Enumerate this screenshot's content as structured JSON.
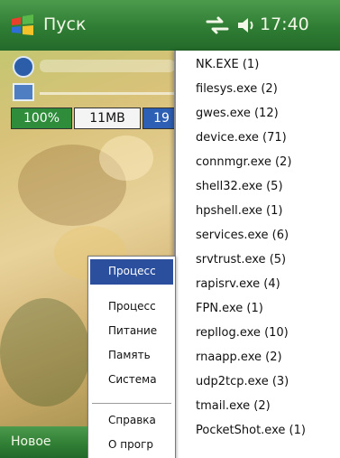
{
  "title_bar": {
    "start_label": "Пуск",
    "time": "17:40",
    "icons": [
      "windows-flag-icon",
      "connectivity-icon",
      "volume-icon"
    ]
  },
  "status_row": {
    "battery": "100%",
    "memory": "11MB",
    "cpu": "19"
  },
  "process_list": [
    "NK.EXE (1)",
    "filesys.exe (2)",
    "gwes.exe (12)",
    "device.exe (71)",
    "connmgr.exe (2)",
    "shell32.exe (5)",
    "hpshell.exe (1)",
    "services.exe (6)",
    "srvtrust.exe (5)",
    "rapisrv.exe (4)",
    "FPN.exe (1)",
    "repllog.exe (10)",
    "rnaapp.exe (2)",
    "udp2tcp.exe (3)",
    "tmail.exe (2)",
    "PocketShot.exe (1)"
  ],
  "context_menu": {
    "selected": "Процесс",
    "group1": [
      "Процесс",
      "Питание",
      "Память",
      "Система"
    ],
    "group2": [
      "Справка",
      "О прогр"
    ]
  },
  "bottom_bar": {
    "left_softkey": "Новое"
  },
  "colors": {
    "title_bar": "#2f7d34",
    "menu_selection": "#2b4f9c",
    "battery_segment": "#2e8c3b",
    "cpu_segment": "#2d5fb5"
  }
}
